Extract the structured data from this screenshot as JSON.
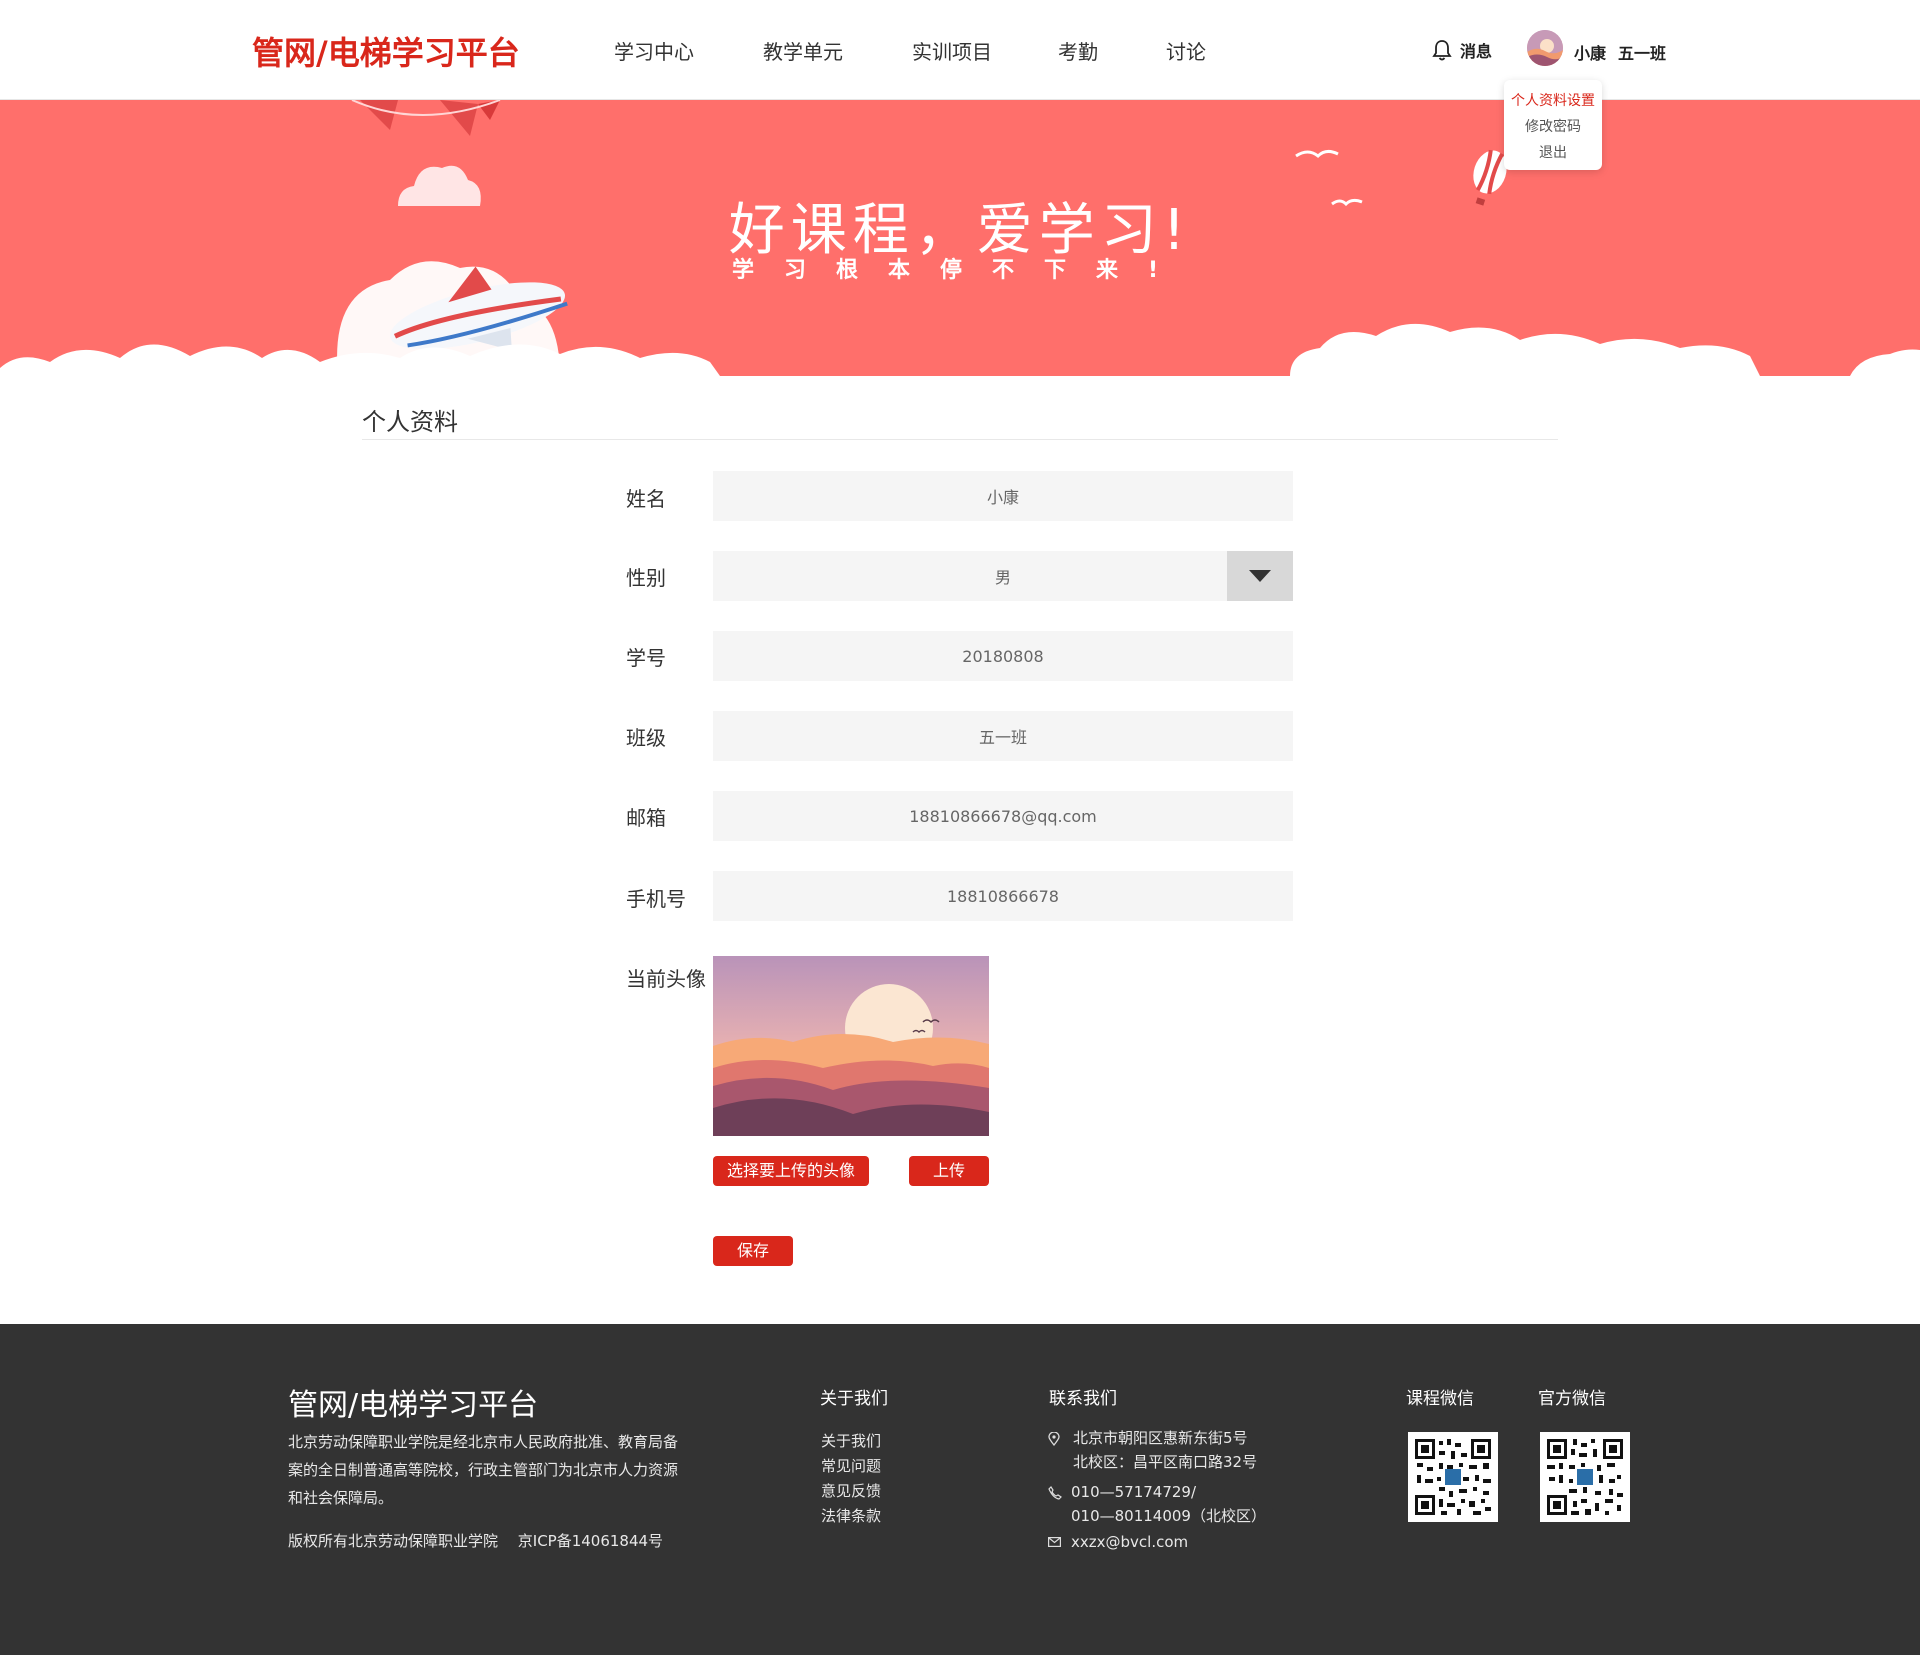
{
  "header": {
    "logo": "管网/电梯学习平台",
    "nav": [
      "学习中心",
      "教学单元",
      "实训项目",
      "考勤",
      "讨论"
    ],
    "messages_label": "消息",
    "user_name": "小康",
    "user_class": "五一班",
    "dropdown": [
      "个人资料设置",
      "修改密码",
      "退出"
    ]
  },
  "banner": {
    "title": "好课程，爱学习!",
    "subtitle": "学习根本停不下来!"
  },
  "profile": {
    "section_title": "个人资料",
    "fields": [
      {
        "label": "姓名",
        "value": "小康"
      },
      {
        "label": "性别",
        "value": "男"
      },
      {
        "label": "学号",
        "value": "20180808"
      },
      {
        "label": "班级",
        "value": "五一班"
      },
      {
        "label": "邮箱",
        "value": "18810866678@qq.com"
      },
      {
        "label": "手机号",
        "value": "18810866678"
      }
    ],
    "avatar_label": "当前头像",
    "choose_button": "选择要上传的头像",
    "upload_button": "上传",
    "save_button": "保存"
  },
  "footer": {
    "title": "管网/电梯学习平台",
    "description": "北京劳动保障职业学院是经北京市人民政府批准、教育局备案的全日制普通高等院校，行政主管部门为北京市人力资源和社会保障局。",
    "copyright": "版权所有北京劳动保障职业学院　 京ICP备14061844号",
    "about_heading": "关于我们",
    "about_links": [
      "关于我们",
      "常见问题",
      "意见反馈",
      "法律条款"
    ],
    "contact_heading": "联系我们",
    "address_line1": "北京市朝阳区惠新东街5号",
    "address_line2": "北校区：昌平区南口路32号",
    "phone_line1": "010—57174729/",
    "phone_line2": "010—80114009（北校区）",
    "email": "xxzx@bvcl.com",
    "wechat_course": "课程微信",
    "wechat_official": "官方微信"
  },
  "colors": {
    "brand_red": "#d9271b",
    "banner_bg": "#ff6f6b",
    "footer_bg": "#333333"
  }
}
